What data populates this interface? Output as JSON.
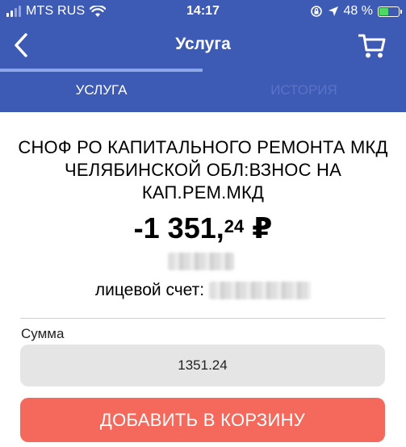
{
  "status_bar": {
    "carrier": "MTS RUS",
    "time": "14:17",
    "battery_percent_text": "48 %",
    "battery_level": 0.48
  },
  "nav": {
    "title": "Услуга",
    "back_icon": "chevron-left-icon",
    "cart_icon": "cart-icon"
  },
  "tabs": [
    {
      "label": "УСЛУГА",
      "active": true
    },
    {
      "label": "ИСТОРИЯ",
      "active": false
    }
  ],
  "service": {
    "title": "СНОФ РО КАПИТАЛЬНОГО РЕМОНТА МКД ЧЕЛЯБИНСКОЙ ОБЛ:ВЗНОС НА КАП.РЕМ.МКД",
    "amount_main": "-1 351,",
    "amount_fraction": "24",
    "currency": "₽",
    "account_label": "лицевой счет:"
  },
  "form": {
    "sum_label": "Сумма",
    "sum_value": "1351.24",
    "add_button_label": "ДОБАВИТЬ В КОРЗИНУ"
  },
  "colors": {
    "header_bg": "#3d5ab5",
    "button_bg": "#f4695c",
    "input_bg": "#e5e5e5"
  }
}
